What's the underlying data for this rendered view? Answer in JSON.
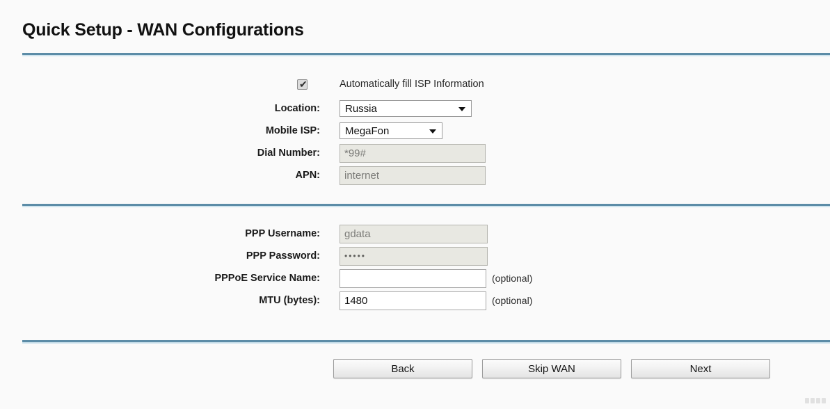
{
  "page": {
    "title": "Quick Setup - WAN Configurations",
    "background_color": "#fafafa",
    "divider_color": "#5c8ca7"
  },
  "isp_section": {
    "auto_fill": {
      "label": "Automatically fill ISP Information",
      "checked": true,
      "checkmark": "✔"
    },
    "fields": [
      {
        "name": "location",
        "label": "Location:",
        "type": "select",
        "value": "Russia",
        "disabled": false
      },
      {
        "name": "mobile_isp",
        "label": "Mobile ISP:",
        "type": "select",
        "value": "MegaFon",
        "disabled": false
      },
      {
        "name": "dial_number",
        "label": "Dial Number:",
        "type": "text",
        "value": "*99#",
        "disabled": true
      },
      {
        "name": "apn",
        "label": "APN:",
        "type": "text",
        "value": "internet",
        "disabled": true
      }
    ]
  },
  "ppp_section": {
    "fields": [
      {
        "name": "ppp_username",
        "label": "PPP Username:",
        "type": "text",
        "value": "gdata",
        "disabled": true,
        "note": ""
      },
      {
        "name": "ppp_password",
        "label": "PPP Password:",
        "type": "password",
        "value": "•••••",
        "disabled": true,
        "note": ""
      },
      {
        "name": "pppoe_service_name",
        "label": "PPPoE Service Name:",
        "type": "text",
        "value": "",
        "disabled": false,
        "note": "(optional)"
      },
      {
        "name": "mtu",
        "label": "MTU (bytes):",
        "type": "text",
        "value": "1480",
        "disabled": false,
        "note": "(optional)"
      }
    ]
  },
  "buttons": {
    "back": "Back",
    "skip_wan": "Skip WAN",
    "next": "Next"
  },
  "icons": {
    "dropdown_arrow": "chevron-down-icon",
    "resize_handle": "resize-handle-icon"
  }
}
